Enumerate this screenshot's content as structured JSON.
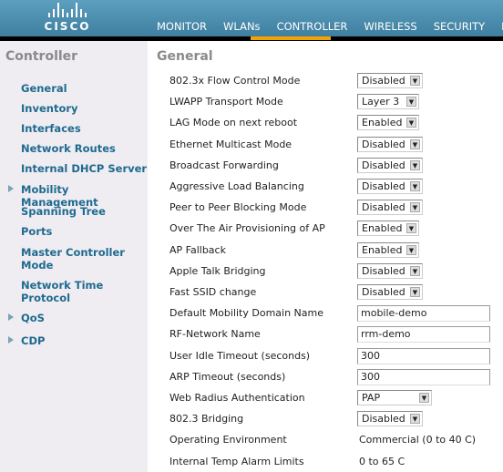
{
  "header": {
    "logo_text": "CISCO",
    "nav": [
      "MONITOR",
      "WLANs",
      "CONTROLLER",
      "WIRELESS",
      "SECURITY",
      "M"
    ],
    "active": "CONTROLLER",
    "accent": "#f4a300"
  },
  "sidebar": {
    "title": "Controller",
    "items": [
      {
        "label": "General",
        "expandable": false
      },
      {
        "label": "Inventory",
        "expandable": false
      },
      {
        "label": "Interfaces",
        "expandable": false
      },
      {
        "label": "Network Routes",
        "expandable": false
      },
      {
        "label": "Internal DHCP Server",
        "expandable": false
      },
      {
        "label": "Mobility Management",
        "expandable": true
      },
      {
        "label": "Spanning Tree",
        "expandable": false
      },
      {
        "label": "Ports",
        "expandable": false
      },
      {
        "label": "Master Controller Mode",
        "expandable": false
      },
      {
        "label": "Network Time Protocol",
        "expandable": false
      },
      {
        "label": "QoS",
        "expandable": true
      },
      {
        "label": "CDP",
        "expandable": true
      }
    ]
  },
  "main": {
    "title": "General",
    "rows": [
      {
        "label": "802.3x Flow Control Mode",
        "type": "select",
        "value": "Disabled"
      },
      {
        "label": "LWAPP Transport Mode",
        "type": "select",
        "value": "Layer 3"
      },
      {
        "label": "LAG Mode on next reboot",
        "type": "select",
        "value": "Enabled"
      },
      {
        "label": "Ethernet Multicast Mode",
        "type": "select",
        "value": "Disabled"
      },
      {
        "label": "Broadcast Forwarding",
        "type": "select",
        "value": "Disabled"
      },
      {
        "label": "Aggressive Load Balancing",
        "type": "select",
        "value": "Disabled"
      },
      {
        "label": "Peer to Peer Blocking Mode",
        "type": "select",
        "value": "Disabled"
      },
      {
        "label": "Over The Air Provisioning of AP",
        "type": "select",
        "value": "Enabled"
      },
      {
        "label": "AP Fallback",
        "type": "select",
        "value": "Enabled"
      },
      {
        "label": "Apple Talk Bridging",
        "type": "select",
        "value": "Disabled"
      },
      {
        "label": "Fast SSID change",
        "type": "select",
        "value": "Disabled"
      },
      {
        "label": "Default Mobility Domain Name",
        "type": "input",
        "value": "mobile-demo"
      },
      {
        "label": "RF-Network Name",
        "type": "input",
        "value": "rrm-demo"
      },
      {
        "label": "User Idle Timeout (seconds)",
        "type": "input",
        "value": "300"
      },
      {
        "label": "ARP Timeout (seconds)",
        "type": "input",
        "value": "300"
      },
      {
        "label": "Web Radius Authentication",
        "type": "select",
        "value": "PAP"
      },
      {
        "label": "802.3 Bridging",
        "type": "select",
        "value": "Disabled"
      },
      {
        "label": "Operating Environment",
        "type": "text",
        "value": "Commercial (0 to 40 C)"
      },
      {
        "label": "Internal Temp Alarm Limits",
        "type": "text",
        "value": "0 to 65 C"
      }
    ]
  }
}
